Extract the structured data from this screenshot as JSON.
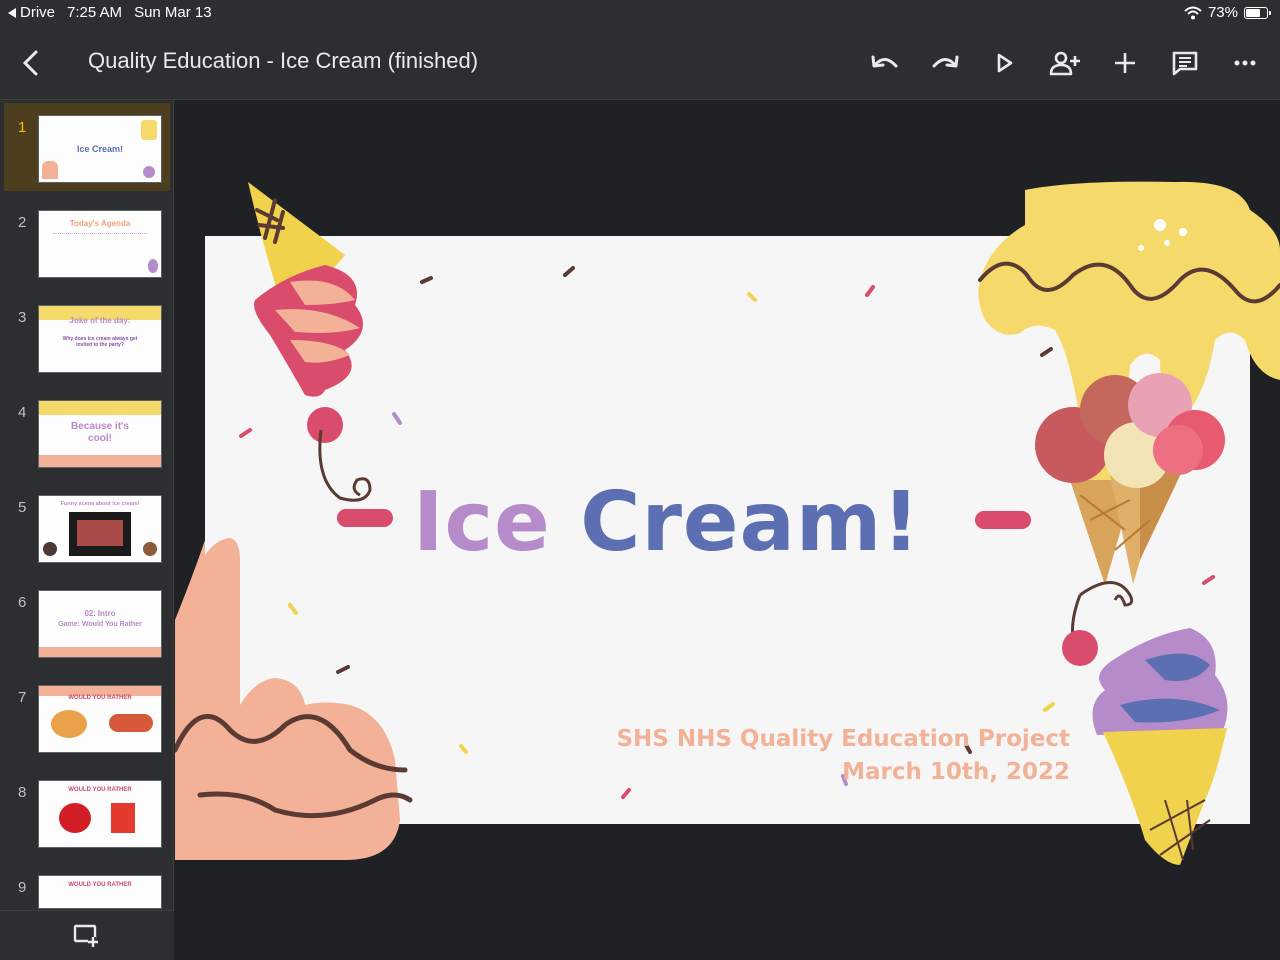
{
  "status_bar": {
    "back_app": "Drive",
    "time": "7:25 AM",
    "date": "Sun Mar 13",
    "battery": "73%",
    "battery_level": 0.73
  },
  "header": {
    "title": "Quality Education - Ice Cream (finished)"
  },
  "toolbar": {
    "icons": [
      "undo-icon",
      "redo-icon",
      "present-icon",
      "share-icon",
      "add-icon",
      "comments-icon",
      "more-icon"
    ]
  },
  "slides": [
    {
      "num": "1",
      "title": "Ice Cream!"
    },
    {
      "num": "2",
      "title": "Today's Agenda"
    },
    {
      "num": "3",
      "title": "Joke of the day:",
      "text": "Why does ice cream always get invited to the party?"
    },
    {
      "num": "4",
      "title": "Because it's cool!"
    },
    {
      "num": "5",
      "title": "Funny scene about ice cream!"
    },
    {
      "num": "6",
      "title": "02. Intro",
      "text": "Game: Would You Rather"
    },
    {
      "num": "7",
      "title": "WOULD YOU RATHER"
    },
    {
      "num": "8",
      "title": "WOULD YOU RATHER"
    },
    {
      "num": "9",
      "title": "WOULD YOU RATHER"
    }
  ],
  "current_slide": {
    "title_word1": "Ice",
    "title_word2": "Cream!",
    "subtitle_line1": "SHS NHS Quality Education Project",
    "subtitle_line2": "March 10th, 2022"
  },
  "colors": {
    "accent_selected": "#fbbc04",
    "title_purple": "#b58bc9",
    "title_blue": "#5b6fb2",
    "subtitle_peach": "#f3b197",
    "drip_yellow": "#f6d96b"
  }
}
